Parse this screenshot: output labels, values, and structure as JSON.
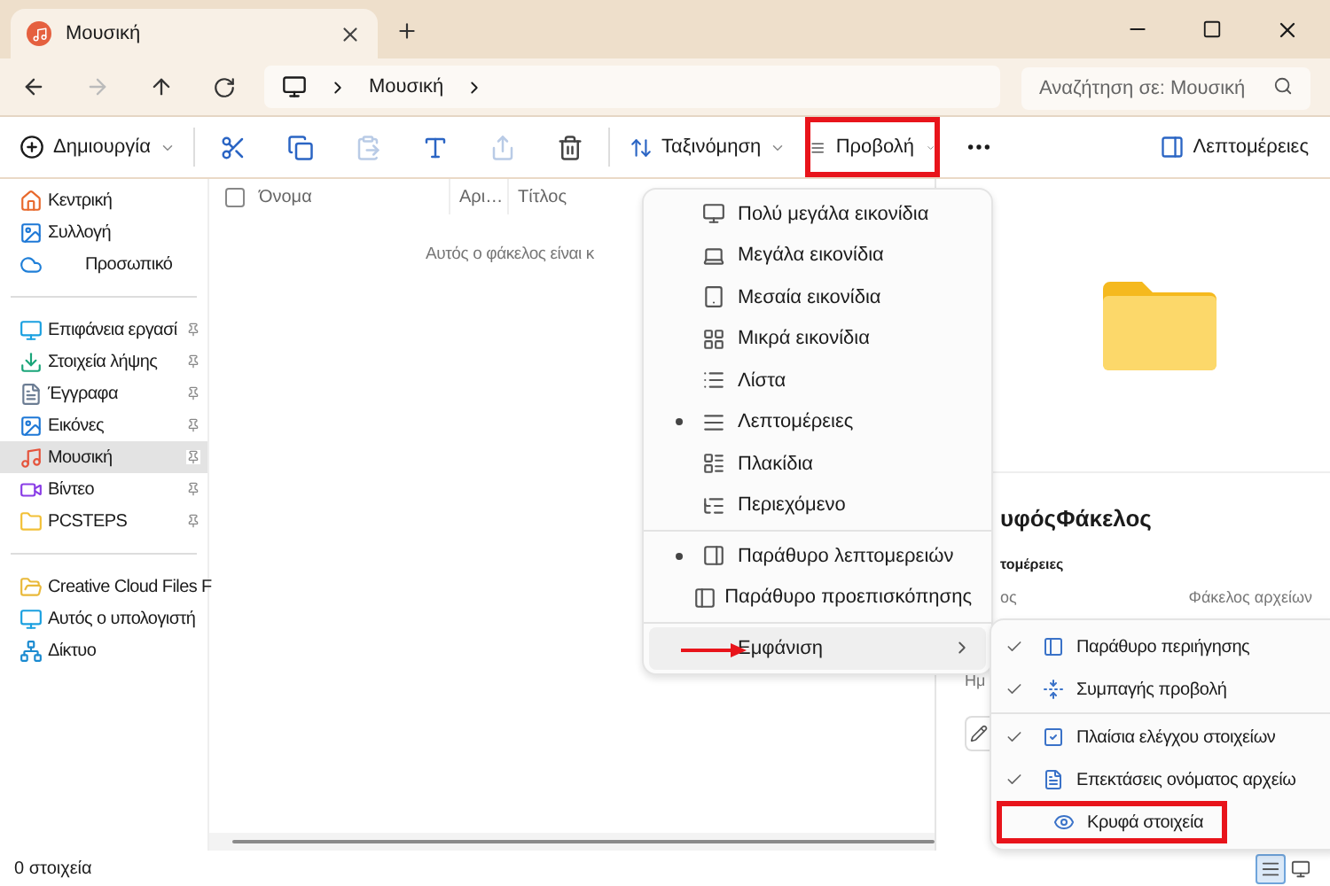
{
  "window": {
    "tab_title": "Μουσική",
    "address": [
      "Μουσική"
    ],
    "search": {
      "placeholder": "Αναζήτηση σε: Μουσική"
    }
  },
  "toolbar": {
    "new_label": "Δημιουργία",
    "sort_label": "Ταξινόμηση",
    "view": {
      "label": "Προβολή",
      "highlighted": true
    },
    "details_label": "Λεπτομέρειες"
  },
  "sidebar": {
    "groups": [
      {
        "items": [
          {
            "label": "Κεντρική",
            "selected": false,
            "pinned": false
          },
          {
            "label": "Συλλογή",
            "selected": false,
            "pinned": false
          },
          {
            "label": "Προσωπικό",
            "selected": false,
            "pinned": false
          }
        ]
      },
      {
        "items": [
          {
            "label": "Επιφάνεια εργασί",
            "selected": false,
            "pinned": true
          },
          {
            "label": "Στοιχεία λήψης",
            "selected": false,
            "pinned": true
          },
          {
            "label": "Έγγραφα",
            "selected": false,
            "pinned": true
          },
          {
            "label": "Εικόνες",
            "selected": false,
            "pinned": true
          },
          {
            "label": "Μουσική",
            "selected": true,
            "pinned": true
          },
          {
            "label": "Βίντεο",
            "selected": false,
            "pinned": true
          },
          {
            "label": "PCSTEPS",
            "selected": false,
            "pinned": true
          }
        ]
      },
      {
        "items": [
          {
            "label": "Creative Cloud Files F",
            "selected": false,
            "pinned": false
          },
          {
            "label": "Αυτός ο υπολογιστή",
            "selected": false,
            "pinned": false
          },
          {
            "label": "Δίκτυο",
            "selected": false,
            "pinned": false
          }
        ]
      }
    ]
  },
  "file_list": {
    "select_all_checked": false,
    "columns": [
      "Όνομα",
      "Αρι…",
      "Τίτλος"
    ],
    "empty_message": "Αυτός ο φάκελος είναι κ"
  },
  "view_menu": {
    "sections": [
      {
        "items": [
          {
            "label": "Πολύ μεγάλα εικονίδια",
            "selected": false
          },
          {
            "label": "Μεγάλα εικονίδια",
            "selected": false
          },
          {
            "label": "Μεσαία εικονίδια",
            "selected": false
          },
          {
            "label": "Μικρά εικονίδια",
            "selected": false
          },
          {
            "label": "Λίστα",
            "selected": false
          },
          {
            "label": "Λεπτομέρειες",
            "selected": true
          },
          {
            "label": "Πλακίδια",
            "selected": false
          },
          {
            "label": "Περιεχόμενο",
            "selected": false
          }
        ]
      },
      {
        "items": [
          {
            "label": "Παράθυρο λεπτομερειών",
            "selected": true
          },
          {
            "label": "Παράθυρο προεπισκόπησης",
            "selected": false
          }
        ]
      },
      {
        "items": [
          {
            "label": "Εμφάνιση",
            "selected": false,
            "submenu": true,
            "pointer_arrow": true
          }
        ]
      }
    ]
  },
  "show_submenu": {
    "items": [
      {
        "label": "Παράθυρο περιήγησης",
        "checked": true,
        "highlighted": false
      },
      {
        "label": "Συμπαγής προβολή",
        "checked": true,
        "highlighted": false
      },
      {
        "label": "Πλαίσια ελέγχου στοιχείων",
        "checked": true,
        "highlighted": false
      },
      {
        "label": "Επεκτάσεις ονόματος αρχείω",
        "checked": true,
        "highlighted": false
      },
      {
        "label": "Κρυφά στοιχεία",
        "checked": false,
        "highlighted": true
      }
    ]
  },
  "details_pane": {
    "title": "υφόςΦάκελος",
    "section": "τομέρειες",
    "field_label": "ος",
    "field_value": "Φάκελος αρχείων",
    "field_label_2": "Ημ"
  },
  "status_bar": {
    "count": "0 στοιχεία",
    "view_buttons": [
      {
        "selected": true
      },
      {
        "selected": false
      }
    ]
  }
}
